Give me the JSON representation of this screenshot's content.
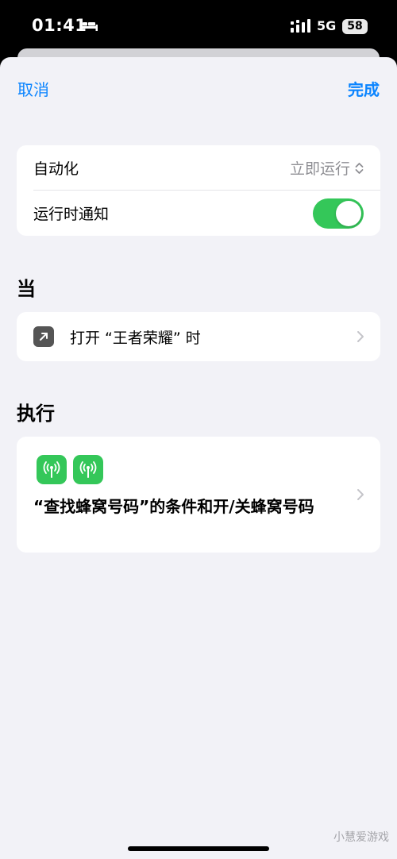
{
  "status_bar": {
    "time": "01:41",
    "network": "5G",
    "battery": "58"
  },
  "nav": {
    "cancel": "取消",
    "done": "完成"
  },
  "settings": {
    "automation_label": "自动化",
    "automation_value": "立即运行",
    "notify_label": "运行时通知",
    "notify_on": true
  },
  "when": {
    "header": "当",
    "trigger_text": "打开 “王者荣耀” 时"
  },
  "do": {
    "header": "执行",
    "action_text": "“查找蜂窝号码”的条件和开/关蜂窝号码"
  },
  "watermark": "小慧爱游戏",
  "colors": {
    "accent": "#0a84ff",
    "toggle_on": "#34c759",
    "background": "#f2f2f7"
  }
}
